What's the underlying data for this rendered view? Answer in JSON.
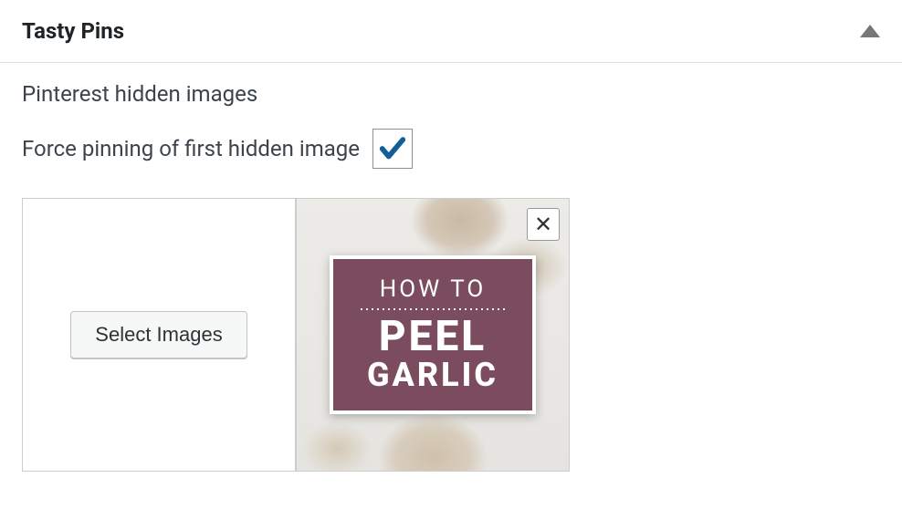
{
  "panel": {
    "title": "Tasty Pins"
  },
  "section": {
    "subtitle": "Pinterest hidden images",
    "forcePinLabel": "Force pinning of first hidden image",
    "forcePinChecked": true
  },
  "buttons": {
    "selectImages": "Select Images",
    "removeImage": "✕"
  },
  "pinImage": {
    "line1": "HOW TO",
    "line2": "PEEL",
    "line3": "GARLIC"
  },
  "colors": {
    "checkmark": "#135e96",
    "pinCardBg": "#7b4b5e"
  }
}
